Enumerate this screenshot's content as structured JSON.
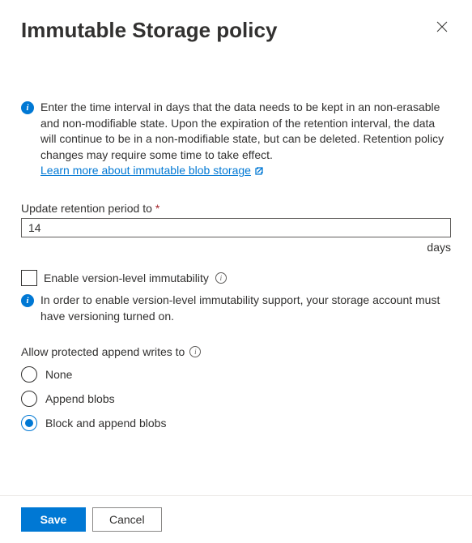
{
  "header": {
    "title": "Immutable Storage policy"
  },
  "info": {
    "body": "Enter the time interval in days that the data needs to be kept in an non-erasable and non-modifiable state. Upon the expiration of the retention interval, the data will continue to be in a non-modifiable state, but can be deleted. Retention policy changes may require some time to take effect.",
    "learn_link": "Learn more about immutable blob storage"
  },
  "retention": {
    "label": "Update retention period to",
    "value": "14",
    "unit": "days"
  },
  "version_immutability": {
    "checkbox_label": "Enable version-level immutability",
    "info_text": "In order to enable version-level immutability support, your storage account must have versioning turned on."
  },
  "append_writes": {
    "label": "Allow protected append writes to",
    "options": {
      "none": "None",
      "append": "Append blobs",
      "block_append": "Block and append blobs"
    },
    "selected": "block_append"
  },
  "footer": {
    "save": "Save",
    "cancel": "Cancel"
  }
}
